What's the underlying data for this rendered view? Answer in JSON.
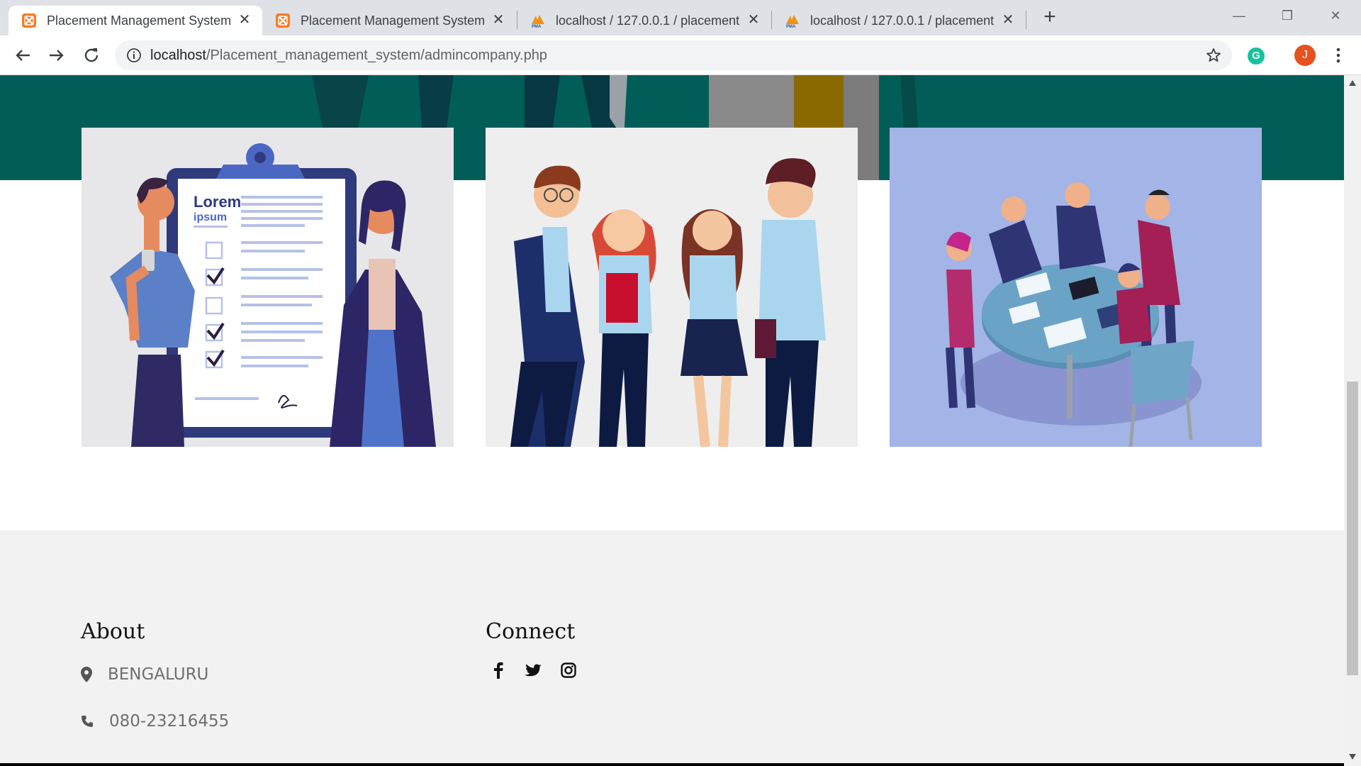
{
  "browser": {
    "tabs": [
      {
        "title": "Placement Management System",
        "icon": "xampp-icon",
        "active": true
      },
      {
        "title": "Placement Management System",
        "icon": "xampp-icon",
        "active": false
      },
      {
        "title": "localhost / 127.0.0.1 / placement",
        "icon": "phpmyadmin-icon",
        "active": false
      },
      {
        "title": "localhost / 127.0.0.1 / placement",
        "icon": "phpmyadmin-icon",
        "active": false
      }
    ],
    "url_host": "localhost",
    "url_path": "/Placement_management_system/admincompany.php",
    "profile_initial": "J",
    "extension_initial": "G"
  },
  "cards": [
    {
      "illustration": "checklist-illustration",
      "heading": "Lorem",
      "subheading": "ipsum"
    },
    {
      "illustration": "students-group-illustration"
    },
    {
      "illustration": "team-meeting-illustration"
    }
  ],
  "footer": {
    "about_title": "About",
    "location": "BENGALURU",
    "phone": "080-23216455",
    "connect_title": "Connect",
    "social_icons": [
      "facebook-icon",
      "twitter-icon",
      "instagram-icon"
    ]
  },
  "colors": {
    "hero_band": "#015d58",
    "footer_bg": "#f2f2f2",
    "card3_bg": "#a3b4e6",
    "accent_orange": "#e8501e"
  }
}
